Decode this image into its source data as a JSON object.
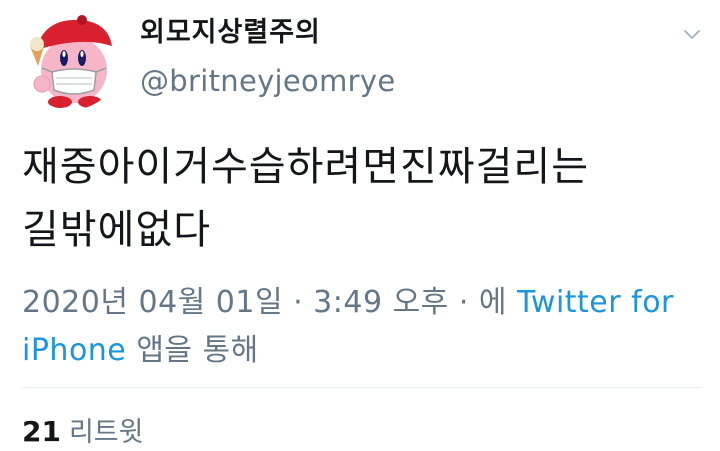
{
  "author": {
    "display_name": "외모지상렬주의",
    "handle": "@britneyjeomrye",
    "avatar_icon": "kirby-mask-avatar-icon"
  },
  "menu_icon": "chevron-down-icon",
  "tweet": {
    "text": "재중아이거수습하려면진짜걸리는\n길밖에없다",
    "timestamp": "2020년 04월 01일 · 3:49 오후 · 에",
    "source_link": "Twitter for iPhone",
    "source_suffix": "앱을 통해"
  },
  "stats": {
    "retweet_count": "21",
    "retweet_label": "리트윗"
  },
  "colors": {
    "link": "#1b95e0",
    "secondary_text": "#657786",
    "primary_text": "#14171a"
  }
}
